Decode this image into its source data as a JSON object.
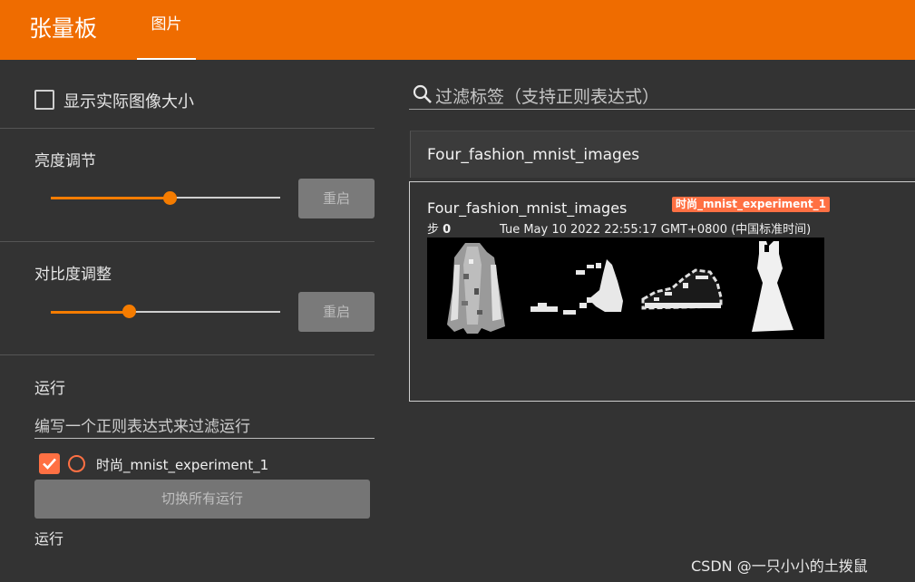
{
  "header": {
    "app_title": "张量板",
    "tabs": [
      {
        "label": "图片",
        "active": true
      }
    ],
    "accent_color": "#ef6c00"
  },
  "sidebar": {
    "show_actual_size_label": "显示实际图像大小",
    "show_actual_size_checked": false,
    "brightness": {
      "label": "亮度调节",
      "value": 0.52,
      "reset_label": "重启"
    },
    "contrast": {
      "label": "对比度调整",
      "value": 0.34,
      "reset_label": "重启"
    },
    "runs": {
      "section_label": "运行",
      "filter_placeholder": "编写一个正则表达式来过滤运行",
      "items": [
        {
          "name": "时尚_mnist_experiment_1",
          "checked": true,
          "color": "#ff7043"
        }
      ],
      "toggle_all_label": "切换所有运行",
      "footer_label": "运行"
    }
  },
  "main": {
    "search_placeholder": "过滤标签（支持正则表达式）",
    "card_header_title": "Four_fashion_mnist_images",
    "image_card": {
      "title": "Four_fashion_mnist_images",
      "run_badge": "时尚_mnist_experiment_1",
      "step_prefix": "步",
      "step_value": "0",
      "timestamp": "Tue May 10 2022 22:55:17 GMT+0800 (中国标准时间)",
      "images": [
        "coat",
        "sandal",
        "sneaker",
        "dress"
      ]
    }
  },
  "watermark": "CSDN @一只小小的土拨鼠"
}
